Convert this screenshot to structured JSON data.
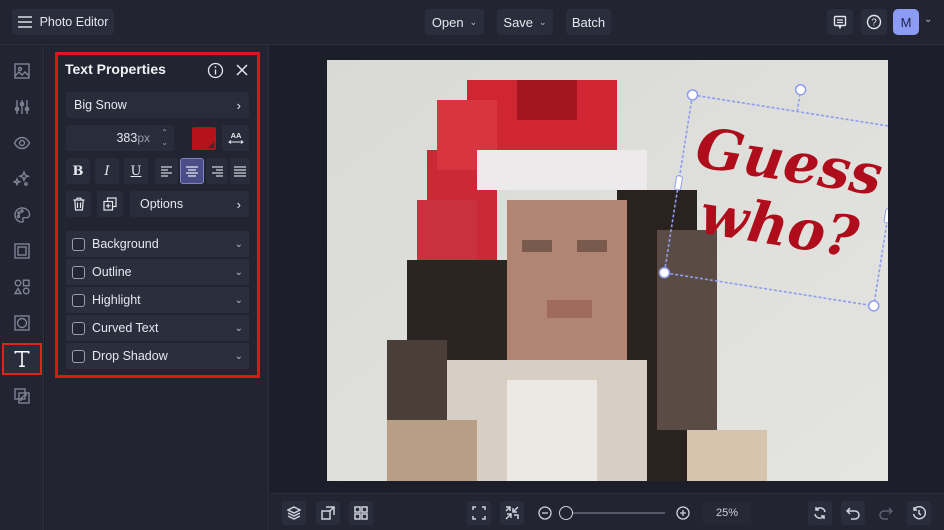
{
  "header": {
    "menu_icon": "hamburger-icon",
    "app_title": "Photo Editor",
    "open_label": "Open",
    "save_label": "Save",
    "batch_label": "Batch",
    "feedback_icon": "chat-icon",
    "help_icon": "help-icon",
    "avatar_initial": "M",
    "avatar_color": "#8c9cf5"
  },
  "sidebar": {
    "items": [
      {
        "name": "image",
        "icon": "image-icon"
      },
      {
        "name": "adjust",
        "icon": "sliders-icon"
      },
      {
        "name": "view",
        "icon": "eye-icon"
      },
      {
        "name": "effects",
        "icon": "sparkle-icon"
      },
      {
        "name": "artsy",
        "icon": "palette-icon"
      },
      {
        "name": "frames",
        "icon": "frame-icon"
      },
      {
        "name": "graphics",
        "icon": "shapes-icon"
      },
      {
        "name": "overlays",
        "icon": "texture-icon"
      },
      {
        "name": "text",
        "icon": "text-icon",
        "active": true
      },
      {
        "name": "cutout",
        "icon": "layers-cutout-icon"
      }
    ]
  },
  "text_properties": {
    "title": "Text Properties",
    "font_name": "Big Snow",
    "font_size": "383",
    "font_size_unit": "px",
    "text_color": "#b5121b",
    "alignment": "center",
    "options_label": "Options",
    "sections": [
      {
        "label": "Background",
        "checked": false
      },
      {
        "label": "Outline",
        "checked": false
      },
      {
        "label": "Highlight",
        "checked": false
      },
      {
        "label": "Curved Text",
        "checked": false
      },
      {
        "label": "Drop Shadow",
        "checked": false
      }
    ]
  },
  "canvas": {
    "text_line1": "Guess",
    "text_line2": "who?",
    "text_color": "#b00d1c",
    "selection_color": "#8e9cf0"
  },
  "bottom": {
    "zoom_value": "25%",
    "zoom_fraction": 0.03
  },
  "accent": {
    "highlight_border": "#e0141b",
    "active_align_bg": "#4b4e86"
  }
}
